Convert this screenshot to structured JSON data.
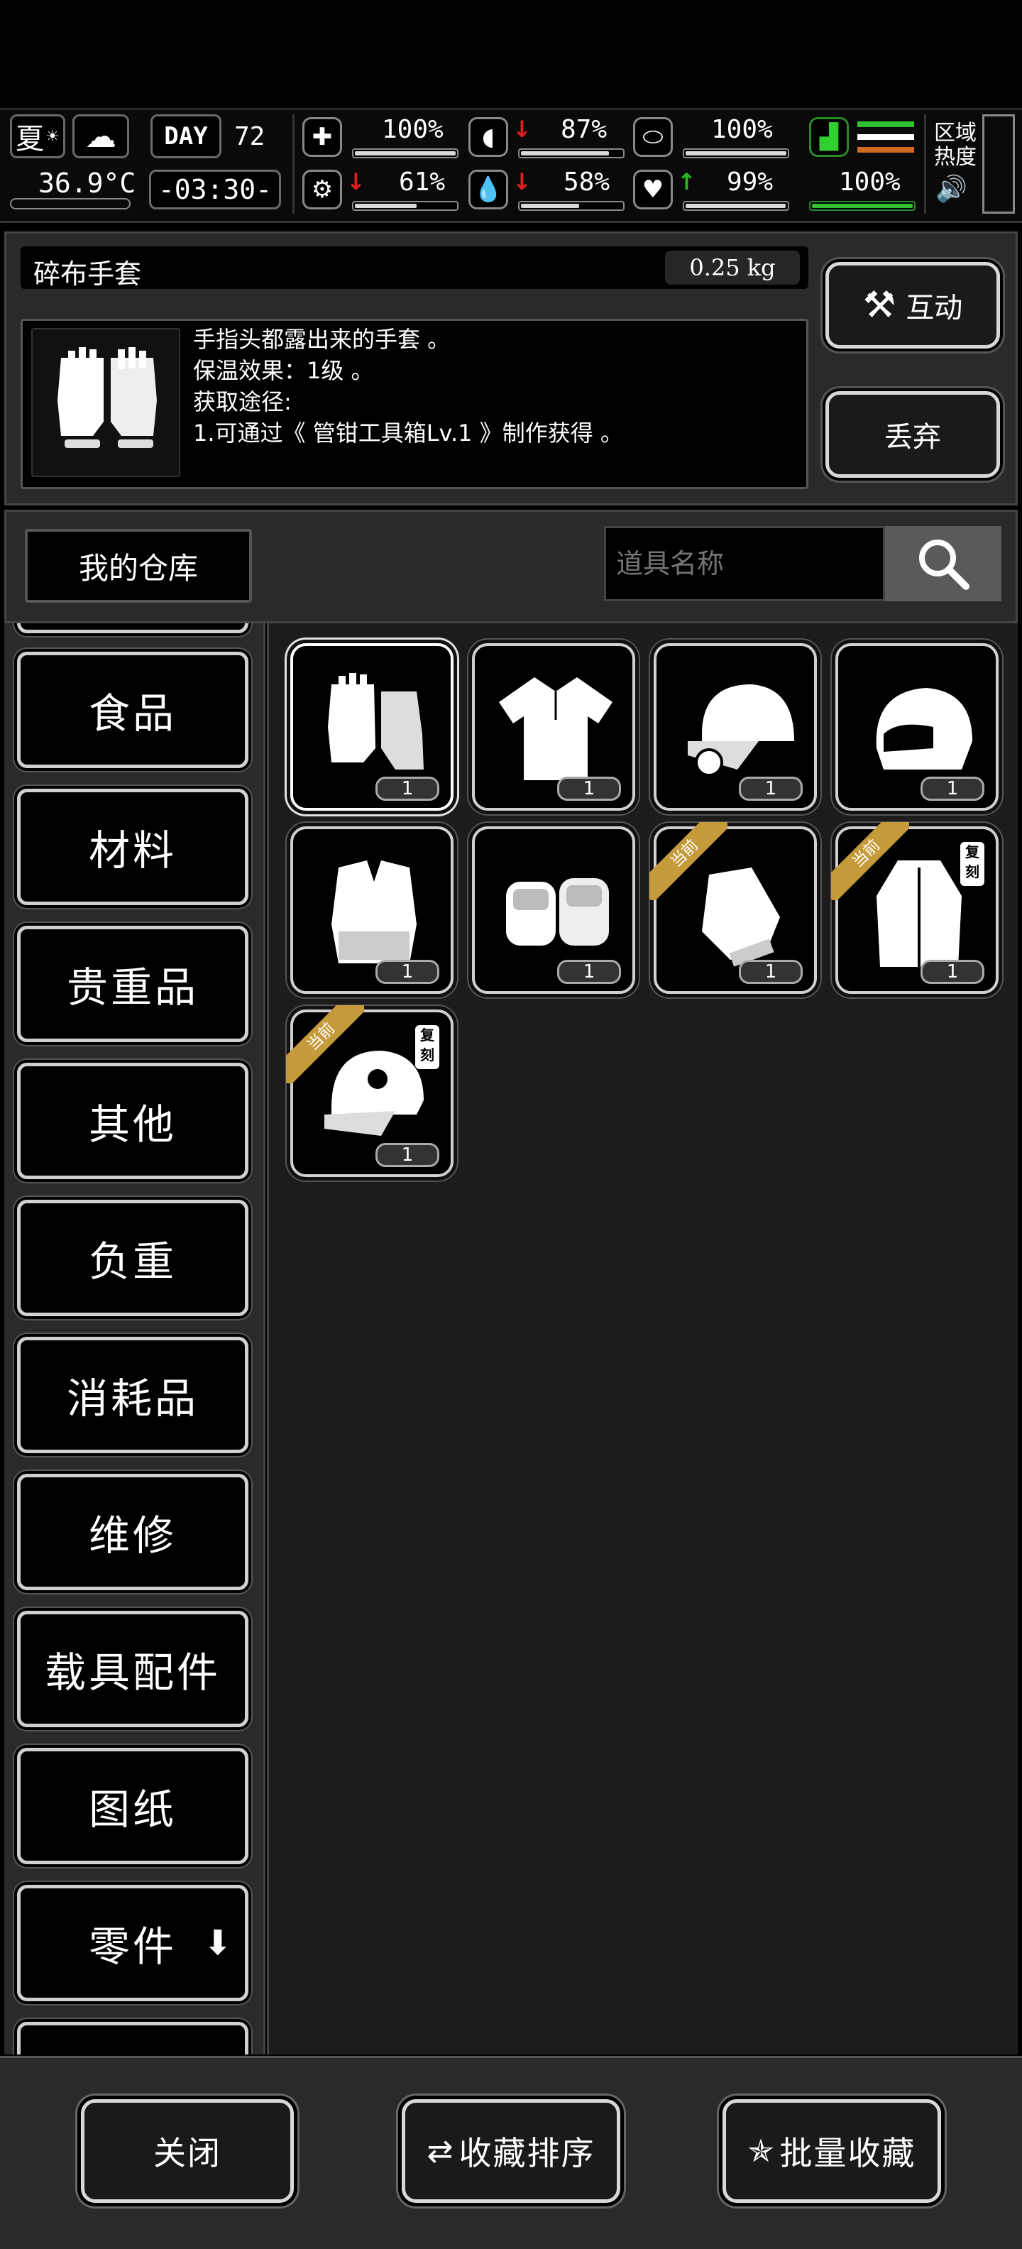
{
  "status": {
    "season": "夏",
    "temperature": "36.9°C",
    "day_label": "DAY",
    "day_number": "72",
    "clock": "-03:30-",
    "stats": [
      {
        "name": "health",
        "icon": "medkit-icon",
        "value": "100%",
        "arrow": "",
        "fill": 1.0
      },
      {
        "name": "hunger",
        "icon": "stomach-icon",
        "value": "87%",
        "arrow": "down",
        "fill": 0.87
      },
      {
        "name": "armor",
        "icon": "shield-icon",
        "value": "100%",
        "arrow": "",
        "fill": 1.0
      },
      {
        "name": "sanity",
        "icon": "brain-icon",
        "value": "61%",
        "arrow": "down",
        "fill": 0.61
      },
      {
        "name": "thirst",
        "icon": "water-drop-icon",
        "value": "58%",
        "arrow": "down",
        "fill": 0.58
      },
      {
        "name": "mood",
        "icon": "heart-icon",
        "value": "99%",
        "arrow": "up",
        "fill": 0.99
      }
    ],
    "stamina": {
      "value": "100%",
      "fill": 1.0
    },
    "zone_heat_label": "区域热度"
  },
  "detail": {
    "item_name": "碎布手套",
    "weight": "0.25 kg",
    "description": [
      "手指头都露出来的手套 。",
      "保温效果：1级 。",
      "获取途径:",
      "1.可通过《 管钳工具箱Lv.1 》制作获得 。"
    ],
    "interact_label": "互动",
    "discard_label": "丢弃"
  },
  "storage": {
    "title": "我的仓库",
    "search_placeholder": "道具名称"
  },
  "categories": [
    "食品",
    "材料",
    "贵重品",
    "其他",
    "负重",
    "消耗品",
    "维修",
    "载具配件",
    "图纸",
    "零件"
  ],
  "items": [
    {
      "name": "rag-gloves",
      "qty": "1",
      "ribbon": "",
      "badge": "",
      "selected": true
    },
    {
      "name": "shirt",
      "qty": "1",
      "ribbon": "",
      "badge": "",
      "selected": false
    },
    {
      "name": "cap-with-lamp",
      "qty": "1",
      "ribbon": "",
      "badge": "",
      "selected": false
    },
    {
      "name": "motorcycle-helmet",
      "qty": "1",
      "ribbon": "",
      "badge": "",
      "selected": false
    },
    {
      "name": "fur-vest",
      "qty": "1",
      "ribbon": "",
      "badge": "",
      "selected": false
    },
    {
      "name": "knuckle-gloves",
      "qty": "1",
      "ribbon": "",
      "badge": "",
      "selected": false
    },
    {
      "name": "fingerless-gloves",
      "qty": "1",
      "ribbon": "当前",
      "badge": "",
      "selected": false
    },
    {
      "name": "fur-coat",
      "qty": "1",
      "ribbon": "当前",
      "badge": "复刻",
      "selected": false
    },
    {
      "name": "skull-cap",
      "qty": "1",
      "ribbon": "当前",
      "badge": "复刻",
      "selected": false
    }
  ],
  "footer": {
    "close_label": "关闭",
    "sort_label": "收藏排序",
    "batch_label": "批量收藏"
  }
}
